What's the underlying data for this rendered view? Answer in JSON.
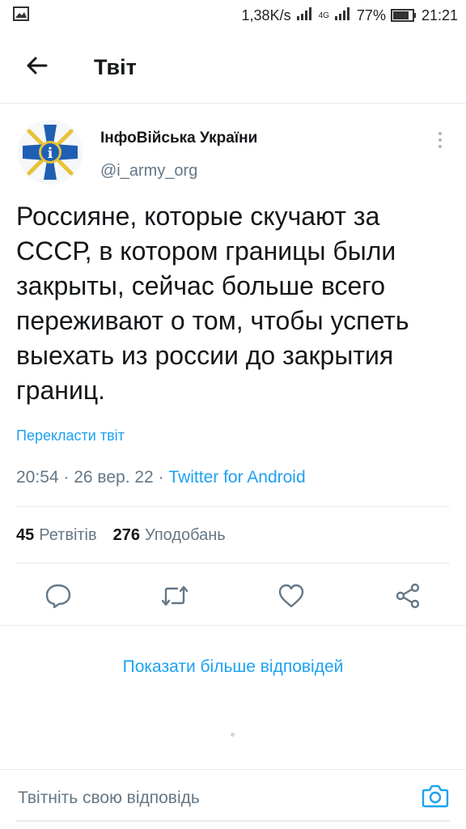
{
  "status_bar": {
    "network_speed": "1,38K/s",
    "network_type": "4G",
    "battery": "77%",
    "time": "21:21",
    "icons": [
      "image-icon",
      "signal-icon",
      "signal-icon",
      "battery-icon"
    ]
  },
  "header": {
    "back_icon": "arrow-left-icon",
    "title": "Твіт"
  },
  "tweet": {
    "author_name": "ІнфоВійська України",
    "author_handle": "@i_army_org",
    "text": "Россияне, которые скучают за СССР, в котором границы были закрыты, сейчас больше всего переживают о том, чтобы успеть выехать из россии до закрытия границ.",
    "translate_label": "Перекласти твіт",
    "time": "20:54",
    "date": "26 вер. 22",
    "separator": " · ",
    "source": "Twitter for Android",
    "retweets_count": "45",
    "retweets_label": "Ретвітів",
    "likes_count": "276",
    "likes_label": "Уподобань"
  },
  "actions": [
    "reply-icon",
    "retweet-icon",
    "like-icon",
    "share-icon"
  ],
  "show_more_label": "Показати більше відповідей",
  "reply": {
    "placeholder": "Твітніть свою відповідь",
    "camera_icon": "camera-icon"
  },
  "colors": {
    "accent": "#1da1f2",
    "secondary_text": "#657786",
    "primary_text": "#14171a",
    "divider": "#e6ecf0",
    "avatar_blue": "#1e5fb4",
    "avatar_gold": "#e8c23a"
  }
}
